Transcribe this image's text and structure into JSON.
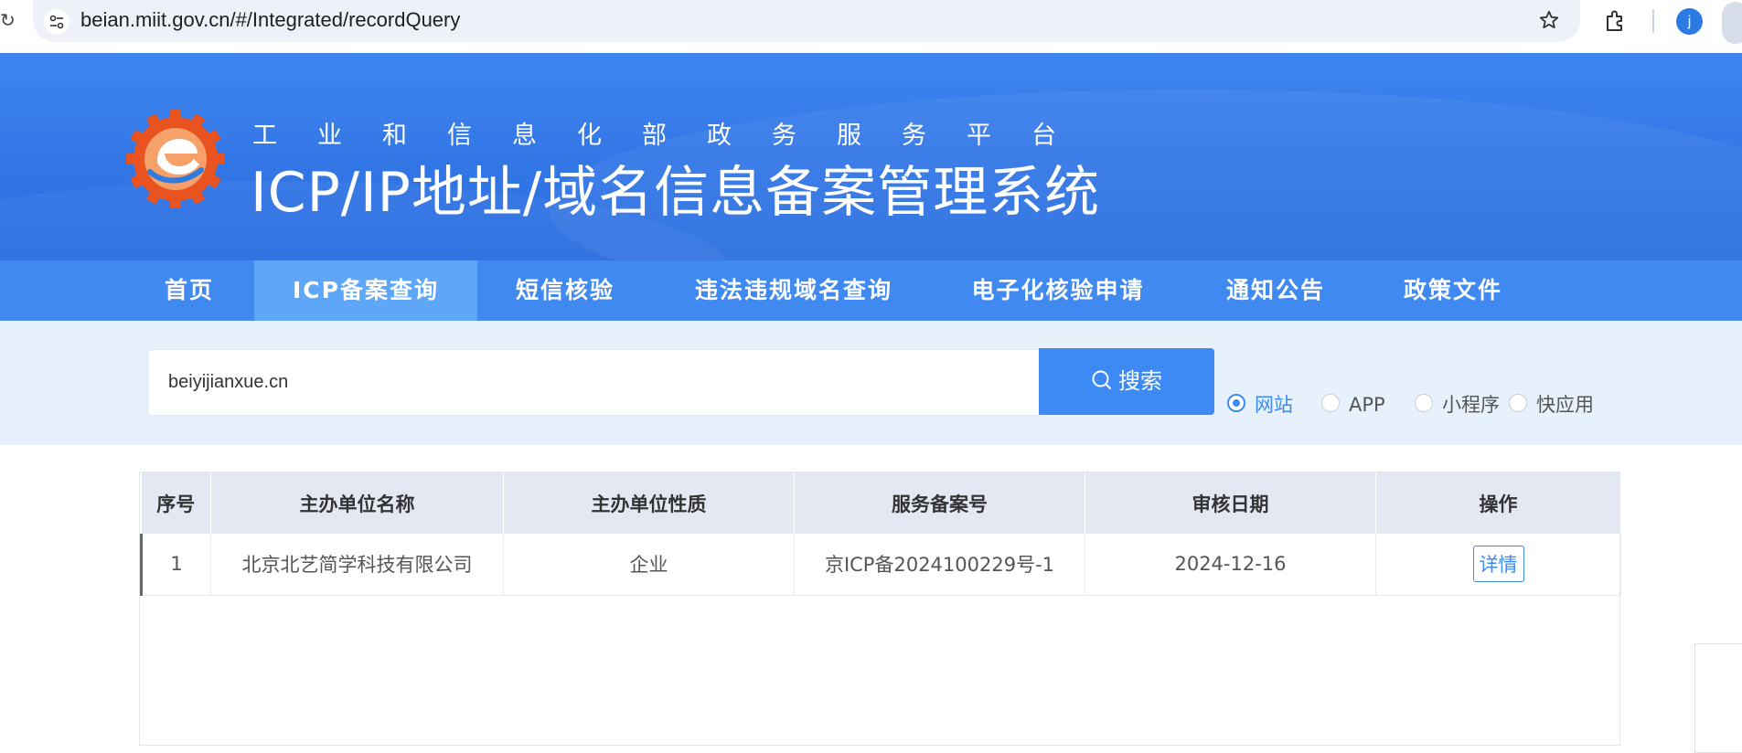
{
  "browser": {
    "url_host": "beian.miit.gov.cn",
    "url_path": "/#/Integrated/recordQuery",
    "avatar_letter": "j",
    "icons": [
      "tune-icon",
      "star-icon",
      "extensions-icon",
      "avatar"
    ]
  },
  "header": {
    "subtitle": "工业和信息化部政务服务平台",
    "title": "ICP/IP地址/域名信息备案管理系统",
    "logo": "miit-gear-logo"
  },
  "nav": {
    "items": [
      {
        "label": "首页"
      },
      {
        "label": "ICP备案查询",
        "active": true
      },
      {
        "label": "短信核验"
      },
      {
        "label": "违法违规域名查询"
      },
      {
        "label": "电子化核验申请"
      },
      {
        "label": "通知公告"
      },
      {
        "label": "政策文件"
      }
    ]
  },
  "search": {
    "value": "beiyijianxue.cn",
    "button_label": "搜索",
    "types": [
      {
        "label": "网站",
        "checked": true
      },
      {
        "label": "APP",
        "checked": false
      },
      {
        "label": "小程序",
        "checked": false
      },
      {
        "label": "快应用",
        "checked": false
      }
    ]
  },
  "table": {
    "headers": [
      "序号",
      "主办单位名称",
      "主办单位性质",
      "服务备案号",
      "审核日期",
      "操作"
    ],
    "rows": [
      [
        "1",
        "北京北艺简学科技有限公司",
        "企业",
        "京ICP备2024100229号-1",
        "2024-12-16",
        "详情"
      ]
    ]
  },
  "colors": {
    "primary": "#3d8af5",
    "nav_bg": "#4089f0",
    "nav_active": "#5ea6f8",
    "banner": "#3276e6",
    "search_bg": "#e7f1fc",
    "table_header_bg": "#e3e8f2"
  }
}
